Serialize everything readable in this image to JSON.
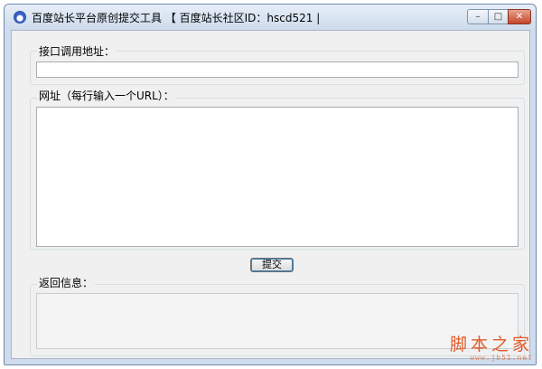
{
  "window": {
    "title": "百度站长平台原创提交工具 【 百度站长社区ID：hscd521 |",
    "min_glyph": "–",
    "max_glyph": "□",
    "close_glyph": "✕"
  },
  "form": {
    "api_label": "接口调用地址：",
    "api_value": "",
    "urls_label": "网址（每行输入一个URL）：",
    "urls_value": "",
    "submit_label": "提交",
    "response_label": "返回信息：",
    "response_value": ""
  },
  "watermark": {
    "main": "脚本之家",
    "sub": "www.jb51.net"
  }
}
